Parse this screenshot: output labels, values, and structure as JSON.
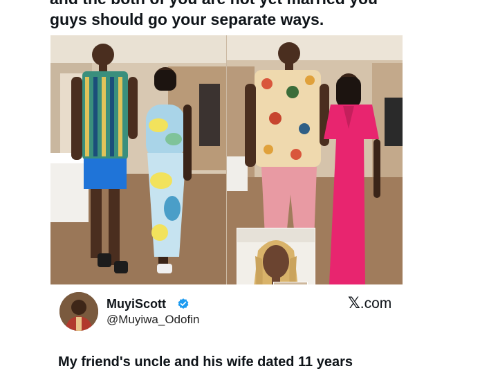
{
  "headline": {
    "line_cut": "and the both of you are not yet married you",
    "line_full": "guys should go your separate ways."
  },
  "post": {
    "display_name": "MuyiScott",
    "handle": "@Muyiwa_Odofin",
    "verified_icon": "verified-badge-icon",
    "site_mark": "𝕏",
    "site_suffix": ".com",
    "body_start": "My friend's uncle and his wife dated 11 years"
  },
  "colors": {
    "text": "#0f1419",
    "verified": "#1d9bf0",
    "dress_pink": "#e8256f",
    "trousers_pink": "#e89aa3",
    "shorts_blue": "#1f74d8"
  }
}
